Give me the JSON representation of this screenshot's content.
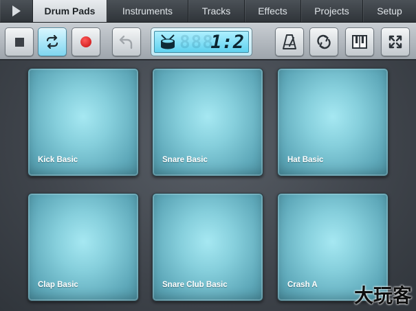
{
  "tabs": {
    "play_icon": "play-icon",
    "items": [
      {
        "label": "Drum Pads",
        "active": true
      },
      {
        "label": "Instruments",
        "active": false
      },
      {
        "label": "Tracks",
        "active": false
      },
      {
        "label": "Effects",
        "active": false
      },
      {
        "label": "Projects",
        "active": false
      },
      {
        "label": "Setup",
        "active": false
      }
    ]
  },
  "toolbar": {
    "buttons": [
      {
        "name": "stop",
        "icon": "stop-icon"
      },
      {
        "name": "loop",
        "icon": "loop-icon",
        "active": true
      },
      {
        "name": "record",
        "icon": "record-icon"
      },
      {
        "name": "undo",
        "icon": "undo-icon",
        "enabled": false
      },
      {
        "name": "metronome",
        "icon": "metronome-icon"
      },
      {
        "name": "sync",
        "icon": "sync-icon"
      },
      {
        "name": "piano",
        "icon": "piano-icon"
      },
      {
        "name": "fullscreen",
        "icon": "fullscreen-icon"
      }
    ],
    "display": {
      "icon": "drum-icon",
      "ghost_digits": "888",
      "time": "1:2"
    }
  },
  "pads": [
    {
      "label": "Kick Basic"
    },
    {
      "label": "Snare Basic"
    },
    {
      "label": "Hat Basic"
    },
    {
      "label": "Clap Basic"
    },
    {
      "label": "Snare Club Basic"
    },
    {
      "label": "Crash A"
    }
  ],
  "watermark": "大玩客",
  "colors": {
    "pad": "#86cfdc",
    "active_tab": "#dfe3e7",
    "record": "#d01414",
    "lcd": "#7fdcf2"
  }
}
